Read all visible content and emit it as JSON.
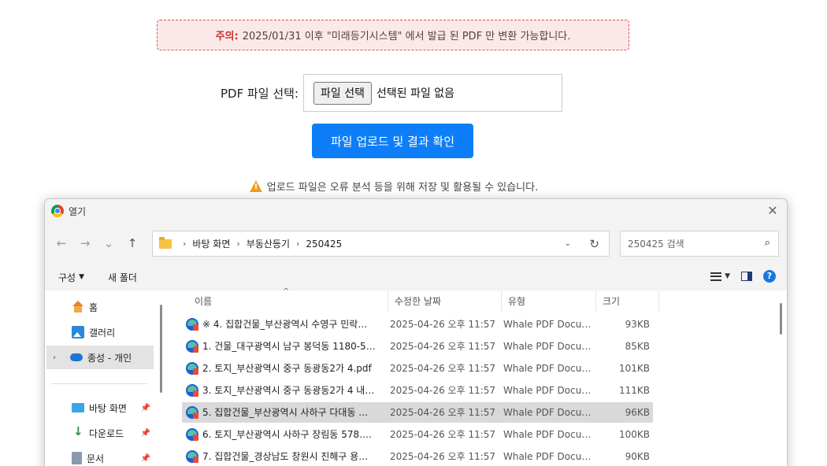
{
  "notice": {
    "label": "주의:",
    "text": "2025/01/31 이후 \"미래등기시스템\" 에서 발급 된 PDF 만 변환 가능합니다."
  },
  "file_input": {
    "label": "PDF 파일 선택:",
    "button": "파일 선택",
    "status": "선택된 파일 없음"
  },
  "upload_button": "파일 업로드 및 결과 확인",
  "warning": "업로드 파일은 오류 분석 등을 위해 저장 및 활용될 수 있습니다.",
  "dialog": {
    "title": "열기",
    "close": "✕",
    "nav": {
      "back": "←",
      "forward": "→",
      "recent": "⌄",
      "up": "↑"
    },
    "breadcrumb": [
      "바탕 화면",
      "부동산등기",
      "250425"
    ],
    "breadcrumb_sep": "›",
    "search_placeholder": "250425 검색",
    "toolbar": {
      "organize": "구성",
      "new_folder": "새 폴더"
    },
    "sidebar": [
      {
        "label": "홈",
        "icon": "home-icon"
      },
      {
        "label": "갤러리",
        "icon": "gallery-icon"
      },
      {
        "label": "종성 - 개인",
        "icon": "onedrive-icon",
        "active": true
      },
      {
        "label": "바탕 화면",
        "icon": "desktop-icon",
        "pinned": true
      },
      {
        "label": "다운로드",
        "icon": "download-icon",
        "pinned": true
      },
      {
        "label": "문서",
        "icon": "documents-icon",
        "pinned": true
      }
    ],
    "columns": {
      "name": "이름",
      "date": "수정한 날짜",
      "type": "유형",
      "size": "크기"
    },
    "files": [
      {
        "name": "※ 4. 집합건물_부산광역시 수영구 민락…",
        "date": "2025-04-26 오후 11:57",
        "type": "Whale PDF Docu…",
        "size": "93KB"
      },
      {
        "name": "1. 건물_대구광역시 남구 봉덕동 1180-5…",
        "date": "2025-04-26 오후 11:57",
        "type": "Whale PDF Docu…",
        "size": "85KB"
      },
      {
        "name": "2. 토지_부산광역시 중구 동광동2가 4.pdf",
        "date": "2025-04-26 오후 11:57",
        "type": "Whale PDF Docu…",
        "size": "101KB"
      },
      {
        "name": "3. 토지_부산광역시 중구 동광동2가 4 내…",
        "date": "2025-04-26 오후 11:57",
        "type": "Whale PDF Docu…",
        "size": "111KB"
      },
      {
        "name": "5. 집합건물_부산광역시 사하구 다대동 …",
        "date": "2025-04-26 오후 11:57",
        "type": "Whale PDF Docu…",
        "size": "96KB",
        "selected": true
      },
      {
        "name": "6. 토지_부산광역시 사하구 장림동 578.…",
        "date": "2025-04-26 오후 11:57",
        "type": "Whale PDF Docu…",
        "size": "100KB"
      },
      {
        "name": "7. 집합건물_경상남도 창원시 진해구 용…",
        "date": "2025-04-26 오후 11:57",
        "type": "Whale PDF Docu…",
        "size": "90KB"
      }
    ]
  },
  "colors": {
    "primary_button": "#0d7ef7",
    "notice_border": "#d9534f",
    "notice_label": "#c9302c",
    "warning_icon": "#f0a020"
  }
}
